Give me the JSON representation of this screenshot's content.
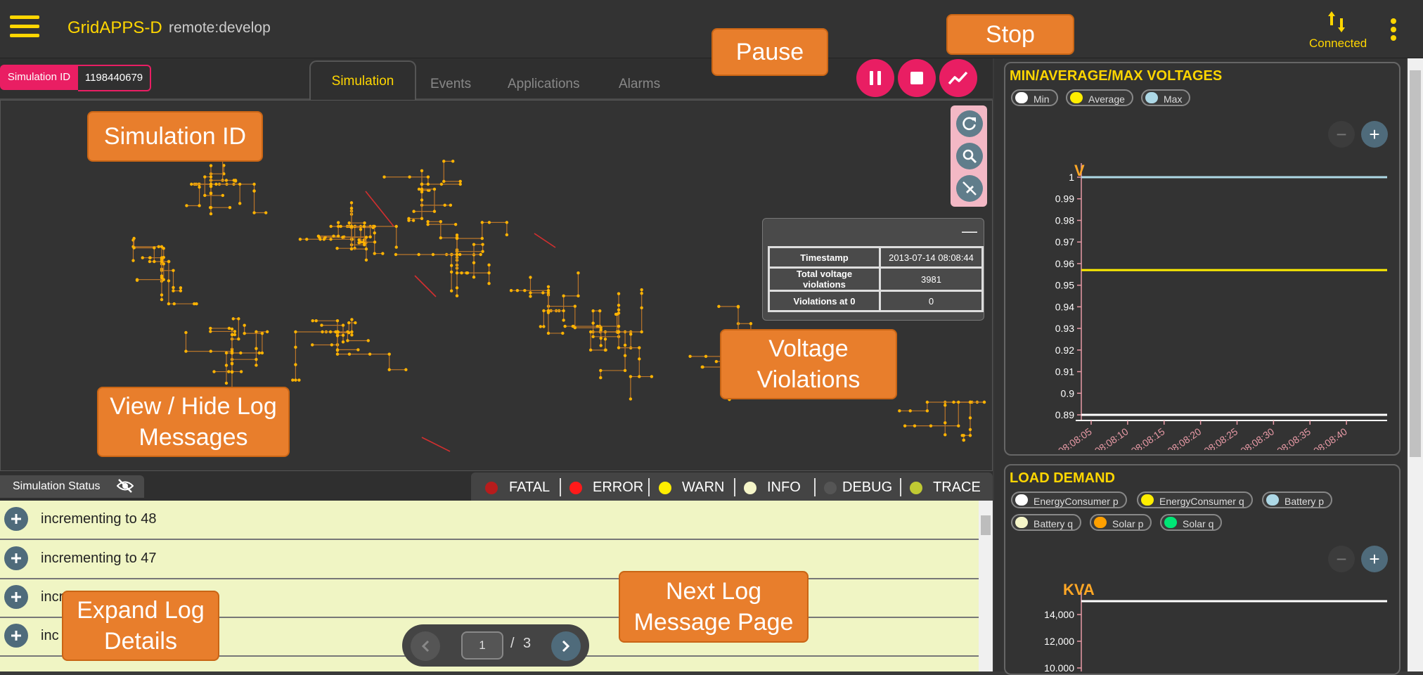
{
  "app": {
    "title": "GridAPPS-D",
    "subtitle": "remote:develop",
    "connection_status": "Connected"
  },
  "simulation": {
    "id_label": "Simulation ID",
    "id_value": "1198440679"
  },
  "tabs": [
    {
      "label": "Simulation",
      "active": true
    },
    {
      "label": "Events",
      "active": false
    },
    {
      "label": "Applications",
      "active": false
    },
    {
      "label": "Alarms",
      "active": false
    }
  ],
  "controls": {
    "pause_icon": "pause-icon",
    "stop_icon": "stop-icon",
    "plot_icon": "chart-icon"
  },
  "map_tools": [
    "refresh-icon",
    "search-icon",
    "no-edit-icon"
  ],
  "violations": {
    "minimize": "—",
    "rows": [
      {
        "key": "Timestamp",
        "value": "2013-07-14 08:08:44"
      },
      {
        "key": "Total voltage violations",
        "value": "3981"
      },
      {
        "key": "Violations at 0",
        "value": "0"
      }
    ]
  },
  "status": {
    "label": "Simulation Status",
    "levels": [
      {
        "name": "FATAL",
        "color": "#b71c1c"
      },
      {
        "name": "ERROR",
        "color": "#ff1a1a"
      },
      {
        "name": "WARN",
        "color": "#ffee00"
      },
      {
        "name": "INFO",
        "color": "#f5f5c8"
      },
      {
        "name": "DEBUG",
        "color": "#555555"
      },
      {
        "name": "TRACE",
        "color": "#c0ca33"
      }
    ]
  },
  "logs": [
    {
      "text": "incrementing to 48"
    },
    {
      "text": "incrementing to 47"
    },
    {
      "text": "incr"
    },
    {
      "text": "inc"
    }
  ],
  "pager": {
    "current": "1",
    "slash": "/",
    "total": "3"
  },
  "voltage_card": {
    "title": "MIN/AVERAGE/MAX VOLTAGES",
    "legend": [
      {
        "label": "Min",
        "color": "#ffffff"
      },
      {
        "label": "Average",
        "color": "#ffee00"
      },
      {
        "label": "Max",
        "color": "#add8e6"
      }
    ],
    "zoom_out": "−",
    "zoom_in": "+"
  },
  "load_card": {
    "title": "LOAD DEMAND",
    "legend": [
      {
        "label": "EnergyConsumer p",
        "color": "#ffffff"
      },
      {
        "label": "EnergyConsumer q",
        "color": "#ffee00"
      },
      {
        "label": "Battery p",
        "color": "#add8e6"
      },
      {
        "label": "Battery q",
        "color": "#f5f5c8"
      },
      {
        "label": "Solar p",
        "color": "#ffa000"
      },
      {
        "label": "Solar q",
        "color": "#00e676"
      }
    ],
    "zoom_out": "−",
    "zoom_in": "+"
  },
  "chart_data": [
    {
      "type": "line",
      "title": "MIN/AVERAGE/MAX VOLTAGES",
      "ylabel": "V",
      "x": [
        "08:08:05",
        "08:08:10",
        "08:08:15",
        "08:08:20",
        "08:08:25",
        "08:08:30",
        "08:08:35",
        "08:08:40"
      ],
      "yticks": [
        "0.89",
        "0.9",
        "0.91",
        "0.92",
        "0.93",
        "0.94",
        "0.95",
        "0.96",
        "0.97",
        "0.98",
        "0.99",
        "1"
      ],
      "ylim": [
        0.89,
        1.0
      ],
      "series": [
        {
          "name": "Min",
          "color": "#ffffff",
          "values": [
            0.89,
            0.89,
            0.89,
            0.89,
            0.89,
            0.89,
            0.89,
            0.89
          ]
        },
        {
          "name": "Average",
          "color": "#ffee00",
          "values": [
            0.957,
            0.957,
            0.957,
            0.957,
            0.957,
            0.957,
            0.957,
            0.957
          ]
        },
        {
          "name": "Max",
          "color": "#add8e6",
          "values": [
            1.0,
            1.0,
            1.0,
            1.0,
            1.0,
            1.0,
            1.0,
            1.0
          ]
        }
      ]
    },
    {
      "type": "line",
      "title": "LOAD DEMAND",
      "ylabel": "KVA",
      "yticks": [
        "10,000",
        "12,000",
        "14,000"
      ],
      "series": [
        {
          "name": "EnergyConsumer p",
          "color": "#ffffff",
          "values": [
            15000,
            15000
          ]
        }
      ]
    }
  ],
  "callouts": {
    "pause": "Pause",
    "stop": "Stop",
    "sim_id": "Simulation ID",
    "voltage": "Voltage Violations",
    "view_hide": "View / Hide Log Messages",
    "expand": "Expand Log Details",
    "next_page": "Next Log Message Page"
  }
}
